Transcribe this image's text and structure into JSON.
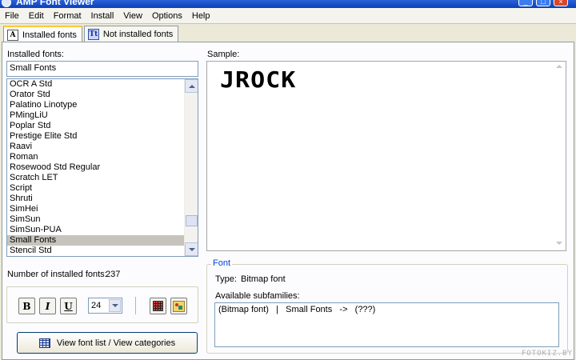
{
  "window": {
    "title": "AMP Font Viewer"
  },
  "menu": [
    "File",
    "Edit",
    "Format",
    "Install",
    "View",
    "Options",
    "Help"
  ],
  "tabs": [
    {
      "label": "Installed fonts",
      "icon": "installed-fonts-icon"
    },
    {
      "label": "Not installed fonts",
      "icon": "not-installed-fonts-icon"
    }
  ],
  "left": {
    "fonts_label": "Installed fonts:",
    "selected_font": "Small Fonts",
    "font_list": [
      "OCR A Std",
      "Orator Std",
      "Palatino Linotype",
      "PMingLiU",
      "Poplar Std",
      "Prestige Elite Std",
      "Raavi",
      "Roman",
      "Rosewood Std Regular",
      "Scratch LET",
      "Script",
      "Shruti",
      "SimHei",
      "SimSun",
      "SimSun-PUA",
      "Small Fonts",
      "Stencil Std"
    ],
    "count_label": "Number of installed fonts:",
    "count": "237",
    "toolbar": {
      "bold": "B",
      "italic": "I",
      "underline": "U",
      "size": "24"
    },
    "view_button": "View font list / View categories"
  },
  "sample": {
    "label": "Sample:",
    "text": "JROCK"
  },
  "font_info": {
    "group_title": "Font",
    "type_label": "Type:",
    "type_value": "Bitmap font",
    "subfamilies_label": "Available subfamilies:",
    "subfamilies_value": "(Bitmap font)   |   Small Fonts   ->   (???)"
  },
  "watermark": "FOTOKIZ.BY"
}
